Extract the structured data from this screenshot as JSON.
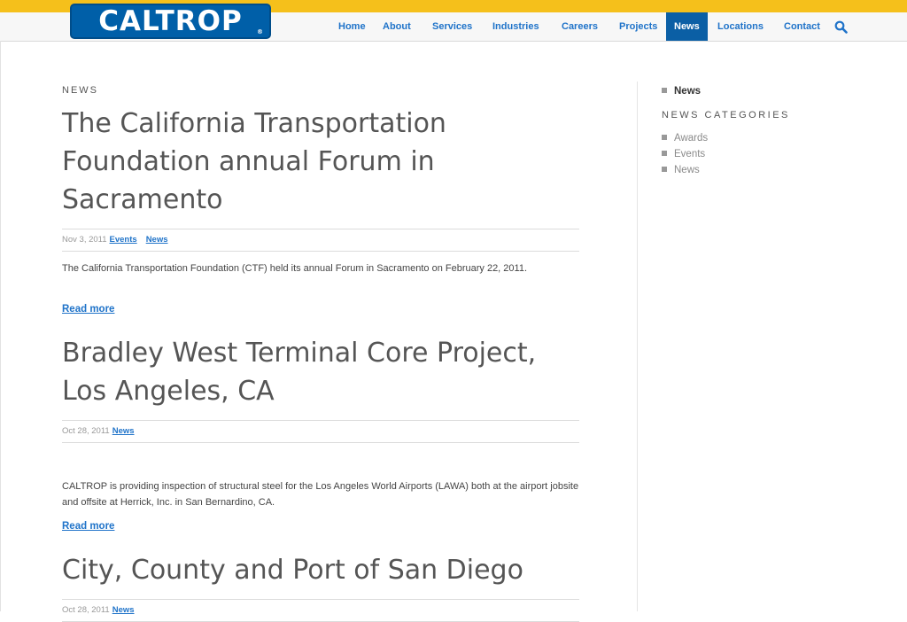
{
  "header": {
    "logo_text": "CALTROP",
    "logo_reg": "®",
    "nav": [
      {
        "label": "Home"
      },
      {
        "label": "About"
      },
      {
        "label": "Services"
      },
      {
        "label": "Industries"
      },
      {
        "label": "Careers"
      },
      {
        "label": "Projects"
      },
      {
        "label": "News",
        "active": true
      },
      {
        "label": "Locations"
      },
      {
        "label": "Contact"
      }
    ],
    "search_icon": "search-icon",
    "colors": {
      "topbar": "#f5c01b",
      "brand_blue": "#005fa8",
      "nav_active": "#0b5fa5",
      "link": "#1f73c9"
    }
  },
  "main": {
    "section_label": "NEWS",
    "posts": [
      {
        "title": "The California Transportation Foundation annual Forum in Sacramento",
        "date": "Nov 3, 2011",
        "categories": [
          "Events",
          "News"
        ],
        "excerpt": "The California Transportation Foundation (CTF) held its annual Forum in Sacramento on February 22, 2011.",
        "read_more": "Read more"
      },
      {
        "title": "Bradley West Terminal Core Project, Los Angeles, CA",
        "date": "Oct 28, 2011",
        "categories": [
          "News"
        ],
        "excerpt": "CALTROP is providing inspection of structural steel for the Los Angeles World Airports (LAWA) both at the airport jobsite and offsite at Herrick, Inc. in San Bernardino, CA.",
        "read_more": "Read more"
      },
      {
        "title": "City, County and Port of San Diego",
        "date": "Oct 28, 2011",
        "categories": [
          "News"
        ]
      }
    ]
  },
  "sidebar": {
    "top_link": "News",
    "categories_heading": "NEWS CATEGORIES",
    "categories": [
      "Awards",
      "Events",
      "News"
    ]
  }
}
